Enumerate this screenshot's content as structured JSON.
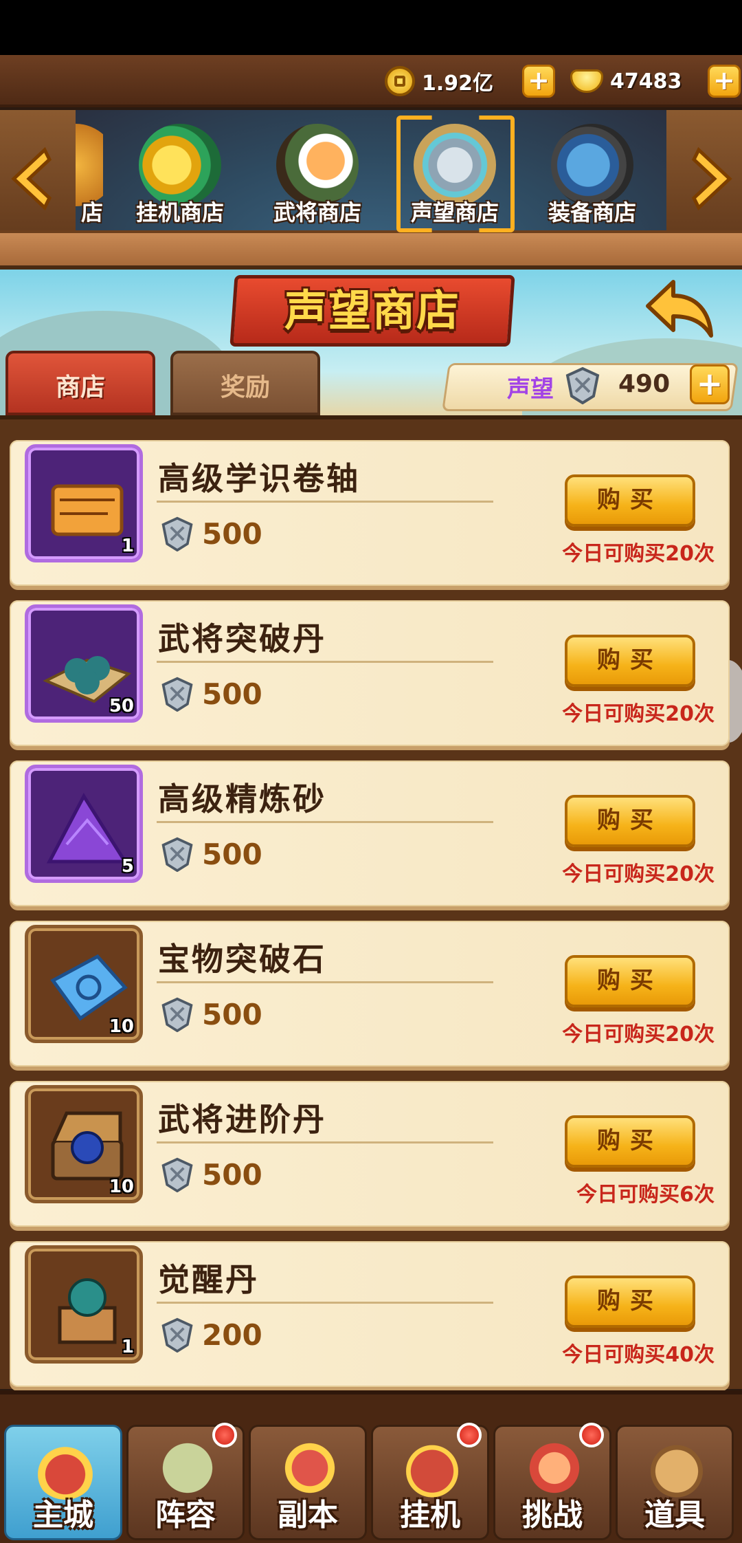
{
  "resources": {
    "gold": "1.92亿",
    "ingot": "47483"
  },
  "shops": [
    {
      "label": "店"
    },
    {
      "label": "挂机商店"
    },
    {
      "label": "武将商店"
    },
    {
      "label": "声望商店"
    },
    {
      "label": "装备商店"
    }
  ],
  "page_title": "声望商店",
  "tabs": {
    "shop": "商店",
    "reward": "奖励"
  },
  "reputation": {
    "label": "声望",
    "value": "490"
  },
  "items": [
    {
      "name": "高级学识卷轴",
      "count": "1",
      "price": "500",
      "buy_label": "购买",
      "limit": "今日可购买20次",
      "rarity": "purple"
    },
    {
      "name": "武将突破丹",
      "count": "50",
      "price": "500",
      "buy_label": "购买",
      "limit": "今日可购买20次",
      "rarity": "purple"
    },
    {
      "name": "高级精炼砂",
      "count": "5",
      "price": "500",
      "buy_label": "购买",
      "limit": "今日可购买20次",
      "rarity": "purple"
    },
    {
      "name": "宝物突破石",
      "count": "10",
      "price": "500",
      "buy_label": "购买",
      "limit": "今日可购买20次",
      "rarity": "orange"
    },
    {
      "name": "武将进阶丹",
      "count": "10",
      "price": "500",
      "buy_label": "购买",
      "limit": "今日可购买6次",
      "rarity": "orange"
    },
    {
      "name": "觉醒丹",
      "count": "1",
      "price": "200",
      "buy_label": "购买",
      "limit": "今日可购买40次",
      "rarity": "orange"
    }
  ],
  "bottom_nav": [
    {
      "label": "主城",
      "icon": "city-gate-icon",
      "badge": false
    },
    {
      "label": "阵容",
      "icon": "formation-icon",
      "badge": true
    },
    {
      "label": "副本",
      "icon": "dungeon-icon",
      "badge": false
    },
    {
      "label": "挂机",
      "icon": "idle-bag-icon",
      "badge": true
    },
    {
      "label": "挑战",
      "icon": "challenge-icon",
      "badge": true
    },
    {
      "label": "道具",
      "icon": "items-jar-icon",
      "badge": false
    }
  ]
}
